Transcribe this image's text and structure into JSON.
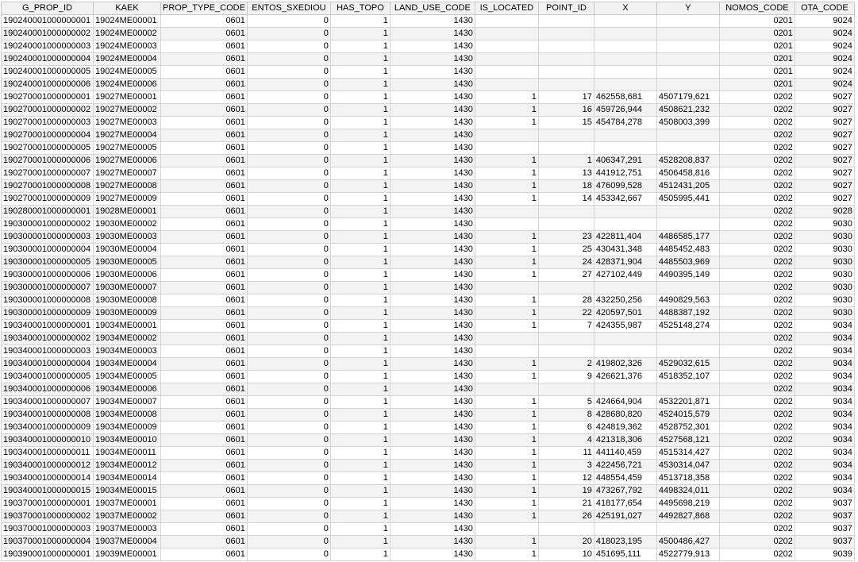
{
  "columns": [
    "G_PROP_ID",
    "KAEK",
    "PROP_TYPE_CODE",
    "ENTOS_SXEDIOU",
    "HAS_TOPO",
    "LAND_USE_CODE",
    "IS_LOCATED",
    "POINT_ID",
    "X",
    "Y",
    "NOMOS_CODE",
    "OTA_CODE"
  ],
  "rows": [
    [
      "190240001000000001",
      "19024ME00001",
      "0601",
      "0",
      "1",
      "1430",
      "",
      "",
      "",
      "",
      "0201",
      "9024"
    ],
    [
      "190240001000000002",
      "19024ME00002",
      "0601",
      "0",
      "1",
      "1430",
      "",
      "",
      "",
      "",
      "0201",
      "9024"
    ],
    [
      "190240001000000003",
      "19024ME00003",
      "0601",
      "0",
      "1",
      "1430",
      "",
      "",
      "",
      "",
      "0201",
      "9024"
    ],
    [
      "190240001000000004",
      "19024ME00004",
      "0601",
      "0",
      "1",
      "1430",
      "",
      "",
      "",
      "",
      "0201",
      "9024"
    ],
    [
      "190240001000000005",
      "19024ME00005",
      "0601",
      "0",
      "1",
      "1430",
      "",
      "",
      "",
      "",
      "0201",
      "9024"
    ],
    [
      "190240001000000006",
      "19024ME00006",
      "0601",
      "0",
      "1",
      "1430",
      "",
      "",
      "",
      "",
      "0201",
      "9024"
    ],
    [
      "190270001000000001",
      "19027ME00001",
      "0601",
      "0",
      "1",
      "1430",
      "1",
      "17",
      "462558,681",
      "4507179,621",
      "0202",
      "9027"
    ],
    [
      "190270001000000002",
      "19027ME00002",
      "0601",
      "0",
      "1",
      "1430",
      "1",
      "16",
      "459726,944",
      "4508621,232",
      "0202",
      "9027"
    ],
    [
      "190270001000000003",
      "19027ME00003",
      "0601",
      "0",
      "1",
      "1430",
      "1",
      "15",
      "454784,278",
      "4508003,399",
      "0202",
      "9027"
    ],
    [
      "190270001000000004",
      "19027ME00004",
      "0601",
      "0",
      "1",
      "1430",
      "",
      "",
      "",
      "",
      "0202",
      "9027"
    ],
    [
      "190270001000000005",
      "19027ME00005",
      "0601",
      "0",
      "1",
      "1430",
      "",
      "",
      "",
      "",
      "0202",
      "9027"
    ],
    [
      "190270001000000006",
      "19027ME00006",
      "0601",
      "0",
      "1",
      "1430",
      "1",
      "1",
      "406347,291",
      "4528208,837",
      "0202",
      "9027"
    ],
    [
      "190270001000000007",
      "19027ME00007",
      "0601",
      "0",
      "1",
      "1430",
      "1",
      "13",
      "441912,751",
      "4506458,816",
      "0202",
      "9027"
    ],
    [
      "190270001000000008",
      "19027ME00008",
      "0601",
      "0",
      "1",
      "1430",
      "1",
      "18",
      "476099,528",
      "4512431,205",
      "0202",
      "9027"
    ],
    [
      "190270001000000009",
      "19027ME00009",
      "0601",
      "0",
      "1",
      "1430",
      "1",
      "14",
      "453342,667",
      "4505995,441",
      "0202",
      "9027"
    ],
    [
      "190280001000000001",
      "19028ME00001",
      "0601",
      "0",
      "1",
      "1430",
      "",
      "",
      "",
      "",
      "0202",
      "9028"
    ],
    [
      "190300001000000002",
      "19030ME00002",
      "0601",
      "0",
      "1",
      "1430",
      "",
      "",
      "",
      "",
      "0202",
      "9030"
    ],
    [
      "190300001000000003",
      "19030ME00003",
      "0601",
      "0",
      "1",
      "1430",
      "1",
      "23",
      "422811,404",
      "4486585,177",
      "0202",
      "9030"
    ],
    [
      "190300001000000004",
      "19030ME00004",
      "0601",
      "0",
      "1",
      "1430",
      "1",
      "25",
      "430431,348",
      "4485452,483",
      "0202",
      "9030"
    ],
    [
      "190300001000000005",
      "19030ME00005",
      "0601",
      "0",
      "1",
      "1430",
      "1",
      "24",
      "428371,904",
      "4485503,969",
      "0202",
      "9030"
    ],
    [
      "190300001000000006",
      "19030ME00006",
      "0601",
      "0",
      "1",
      "1430",
      "1",
      "27",
      "427102,449",
      "4490395,149",
      "0202",
      "9030"
    ],
    [
      "190300001000000007",
      "19030ME00007",
      "0601",
      "0",
      "1",
      "1430",
      "",
      "",
      "",
      "",
      "0202",
      "9030"
    ],
    [
      "190300001000000008",
      "19030ME00008",
      "0601",
      "0",
      "1",
      "1430",
      "1",
      "28",
      "432250,256",
      "4490829,563",
      "0202",
      "9030"
    ],
    [
      "190300001000000009",
      "19030ME00009",
      "0601",
      "0",
      "1",
      "1430",
      "1",
      "22",
      "420597,501",
      "4488387,192",
      "0202",
      "9030"
    ],
    [
      "190340001000000001",
      "19034ME00001",
      "0601",
      "0",
      "1",
      "1430",
      "1",
      "7",
      "424355,987",
      "4525148,274",
      "0202",
      "9034"
    ],
    [
      "190340001000000002",
      "19034ME00002",
      "0601",
      "0",
      "1",
      "1430",
      "",
      "",
      "",
      "",
      "0202",
      "9034"
    ],
    [
      "190340001000000003",
      "19034ME00003",
      "0601",
      "0",
      "1",
      "1430",
      "",
      "",
      "",
      "",
      "0202",
      "9034"
    ],
    [
      "190340001000000004",
      "19034ME00004",
      "0601",
      "0",
      "1",
      "1430",
      "1",
      "2",
      "419802,326",
      "4529032,615",
      "0202",
      "9034"
    ],
    [
      "190340001000000005",
      "19034ME00005",
      "0601",
      "0",
      "1",
      "1430",
      "1",
      "9",
      "426621,376",
      "4518352,107",
      "0202",
      "9034"
    ],
    [
      "190340001000000006",
      "19034ME00006",
      "0601",
      "0",
      "1",
      "1430",
      "",
      "",
      "",
      "",
      "0202",
      "9034"
    ],
    [
      "190340001000000007",
      "19034ME00007",
      "0601",
      "0",
      "1",
      "1430",
      "1",
      "5",
      "424664,904",
      "4532201,871",
      "0202",
      "9034"
    ],
    [
      "190340001000000008",
      "19034ME00008",
      "0601",
      "0",
      "1",
      "1430",
      "1",
      "8",
      "428680,820",
      "4524015,579",
      "0202",
      "9034"
    ],
    [
      "190340001000000009",
      "19034ME00009",
      "0601",
      "0",
      "1",
      "1430",
      "1",
      "6",
      "424819,362",
      "4528752,301",
      "0202",
      "9034"
    ],
    [
      "190340001000000010",
      "19034ME00010",
      "0601",
      "0",
      "1",
      "1430",
      "1",
      "4",
      "421318,306",
      "4527568,121",
      "0202",
      "9034"
    ],
    [
      "190340001000000011",
      "19034ME00011",
      "0601",
      "0",
      "1",
      "1430",
      "1",
      "11",
      "441140,459",
      "4515314,427",
      "0202",
      "9034"
    ],
    [
      "190340001000000012",
      "19034ME00012",
      "0601",
      "0",
      "1",
      "1430",
      "1",
      "3",
      "422456,721",
      "4530314,047",
      "0202",
      "9034"
    ],
    [
      "190340001000000014",
      "19034ME00014",
      "0601",
      "0",
      "1",
      "1430",
      "1",
      "12",
      "448554,459",
      "4513718,358",
      "0202",
      "9034"
    ],
    [
      "190340001000000015",
      "19034ME00015",
      "0601",
      "0",
      "1",
      "1430",
      "1",
      "19",
      "473267,792",
      "4498324,011",
      "0202",
      "9034"
    ],
    [
      "190370001000000001",
      "19037ME00001",
      "0601",
      "0",
      "1",
      "1430",
      "1",
      "21",
      "418177,654",
      "4495698,219",
      "0202",
      "9037"
    ],
    [
      "190370001000000002",
      "19037ME00002",
      "0601",
      "0",
      "1",
      "1430",
      "1",
      "26",
      "425191,027",
      "4492827,868",
      "0202",
      "9037"
    ],
    [
      "190370001000000003",
      "19037ME00003",
      "0601",
      "0",
      "1",
      "1430",
      "",
      "",
      "",
      "",
      "0202",
      "9037"
    ],
    [
      "190370001000000004",
      "19037ME00004",
      "0601",
      "0",
      "1",
      "1430",
      "1",
      "20",
      "418023,195",
      "4500486,427",
      "0202",
      "9037"
    ],
    [
      "190390001000000001",
      "19039ME00001",
      "0601",
      "0",
      "1",
      "1430",
      "1",
      "10",
      "451695,111",
      "4522779,913",
      "0202",
      "9039"
    ]
  ]
}
